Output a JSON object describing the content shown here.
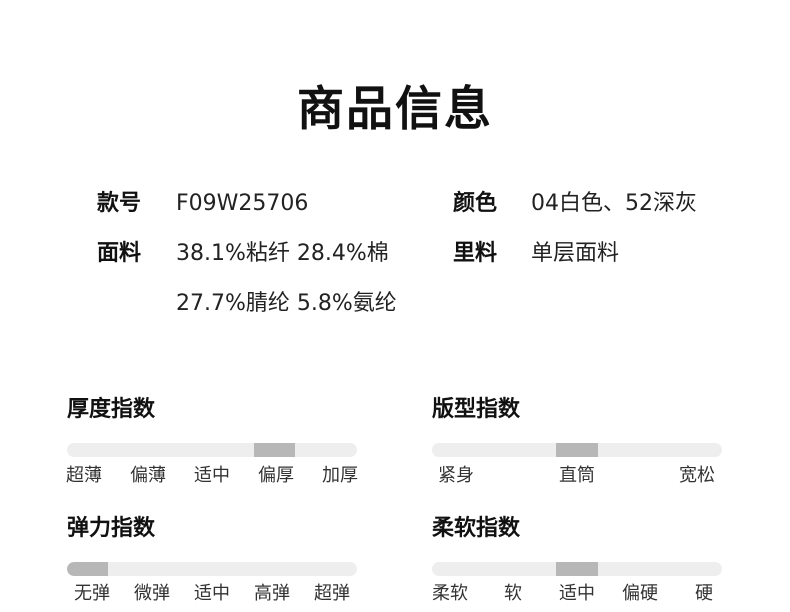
{
  "title": "商品信息",
  "info": {
    "style_no_label": "款号",
    "style_no": "F09W25706",
    "color_label": "颜色",
    "color": "04白色、52深灰",
    "fabric_label": "面料",
    "fabric_line1": "38.1%粘纤 28.4%棉",
    "fabric_line2": "27.7%腈纶 5.8%氨纶",
    "lining_label": "里料",
    "lining": "单层面料"
  },
  "indices": {
    "thickness": {
      "title": "厚度指数",
      "options": [
        "超薄",
        "偏薄",
        "适中",
        "偏厚",
        "加厚"
      ],
      "selected": "偏厚",
      "selected_index": 3
    },
    "fit": {
      "title": "版型指数",
      "options": [
        "紧身",
        "直筒",
        "宽松"
      ],
      "selected": "直筒",
      "selected_index": 1
    },
    "elasticity": {
      "title": "弹力指数",
      "options": [
        "无弹",
        "微弹",
        "适中",
        "高弹",
        "超弹"
      ],
      "selected": "无弹",
      "selected_index": 0
    },
    "softness": {
      "title": "柔软指数",
      "options": [
        "柔软",
        "软",
        "适中",
        "偏硬",
        "硬"
      ],
      "selected": "适中",
      "selected_index": 2
    }
  },
  "colors": {
    "track": "#eeeeee",
    "indicator": "#b7b7b7",
    "text": "#111111"
  }
}
